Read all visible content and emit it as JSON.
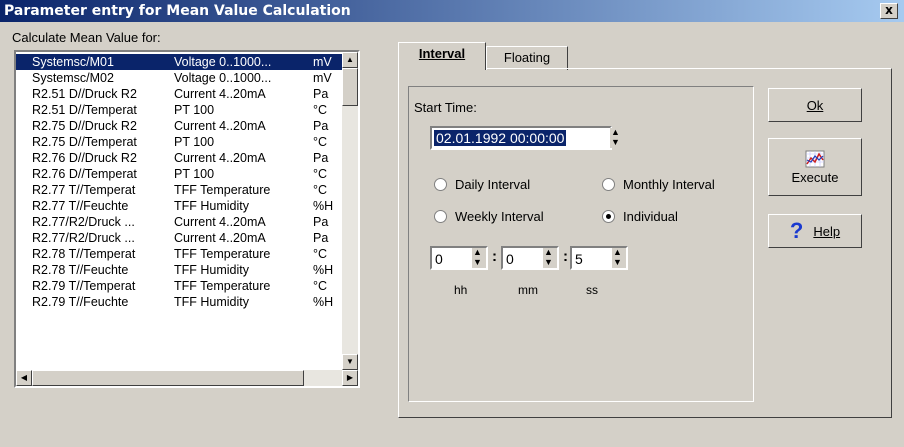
{
  "window": {
    "title": "Parameter entry for Mean Value Calculation",
    "close_label": "x"
  },
  "list": {
    "label": "Calculate Mean Value for:",
    "rows": [
      {
        "name": "Systemsc/M01",
        "type": "Voltage 0..1000...",
        "unit": "mV",
        "selected": true
      },
      {
        "name": "Systemsc/M02",
        "type": "Voltage 0..1000...",
        "unit": "mV"
      },
      {
        "name": "R2.51 D//Druck R2",
        "type": "Current 4..20mA",
        "unit": "Pa"
      },
      {
        "name": "R2.51 D//Temperat",
        "type": "PT 100",
        "unit": "°C"
      },
      {
        "name": "R2.75 D//Druck R2",
        "type": "Current 4..20mA",
        "unit": "Pa"
      },
      {
        "name": "R2.75 D//Temperat",
        "type": "PT 100",
        "unit": "°C"
      },
      {
        "name": "R2.76 D//Druck R2",
        "type": "Current 4..20mA",
        "unit": "Pa"
      },
      {
        "name": "R2.76 D//Temperat",
        "type": "PT 100",
        "unit": "°C"
      },
      {
        "name": "R2.77 T//Temperat",
        "type": "TFF Temperature",
        "unit": "°C"
      },
      {
        "name": "R2.77 T//Feuchte",
        "type": "TFF Humidity",
        "unit": "%H"
      },
      {
        "name": "R2.77/R2/Druck ...",
        "type": "Current 4..20mA",
        "unit": "Pa"
      },
      {
        "name": "R2.77/R2/Druck ...",
        "type": "Current 4..20mA",
        "unit": "Pa"
      },
      {
        "name": "R2.78 T//Temperat",
        "type": "TFF Temperature",
        "unit": "°C"
      },
      {
        "name": "R2.78 T//Feuchte",
        "type": "TFF Humidity",
        "unit": "%H"
      },
      {
        "name": "R2.79 T//Temperat",
        "type": "TFF Temperature",
        "unit": "°C"
      },
      {
        "name": "R2.79 T//Feuchte",
        "type": "TFF Humidity",
        "unit": "%H"
      }
    ]
  },
  "tabs": [
    {
      "label": "Interval",
      "active": true
    },
    {
      "label": "Floating",
      "active": false
    }
  ],
  "interval": {
    "start_time_label": "Start Time:",
    "start_time_value": "02.01.1992 00:00:00",
    "radios": [
      {
        "label": "Daily Interval",
        "checked": false
      },
      {
        "label": "Monthly Interval",
        "checked": false
      },
      {
        "label": "Weekly Interval",
        "checked": false
      },
      {
        "label": "Individual",
        "checked": true
      }
    ],
    "fields": [
      {
        "value": "0",
        "unit": "hh"
      },
      {
        "value": "0",
        "unit": "mm"
      },
      {
        "value": "5",
        "unit": "ss"
      }
    ],
    "separator": ":"
  },
  "buttons": {
    "ok": "Ok",
    "execute": "Execute",
    "help": "Help"
  },
  "icons": {
    "execute": "chart-icon",
    "help": "question-icon"
  }
}
